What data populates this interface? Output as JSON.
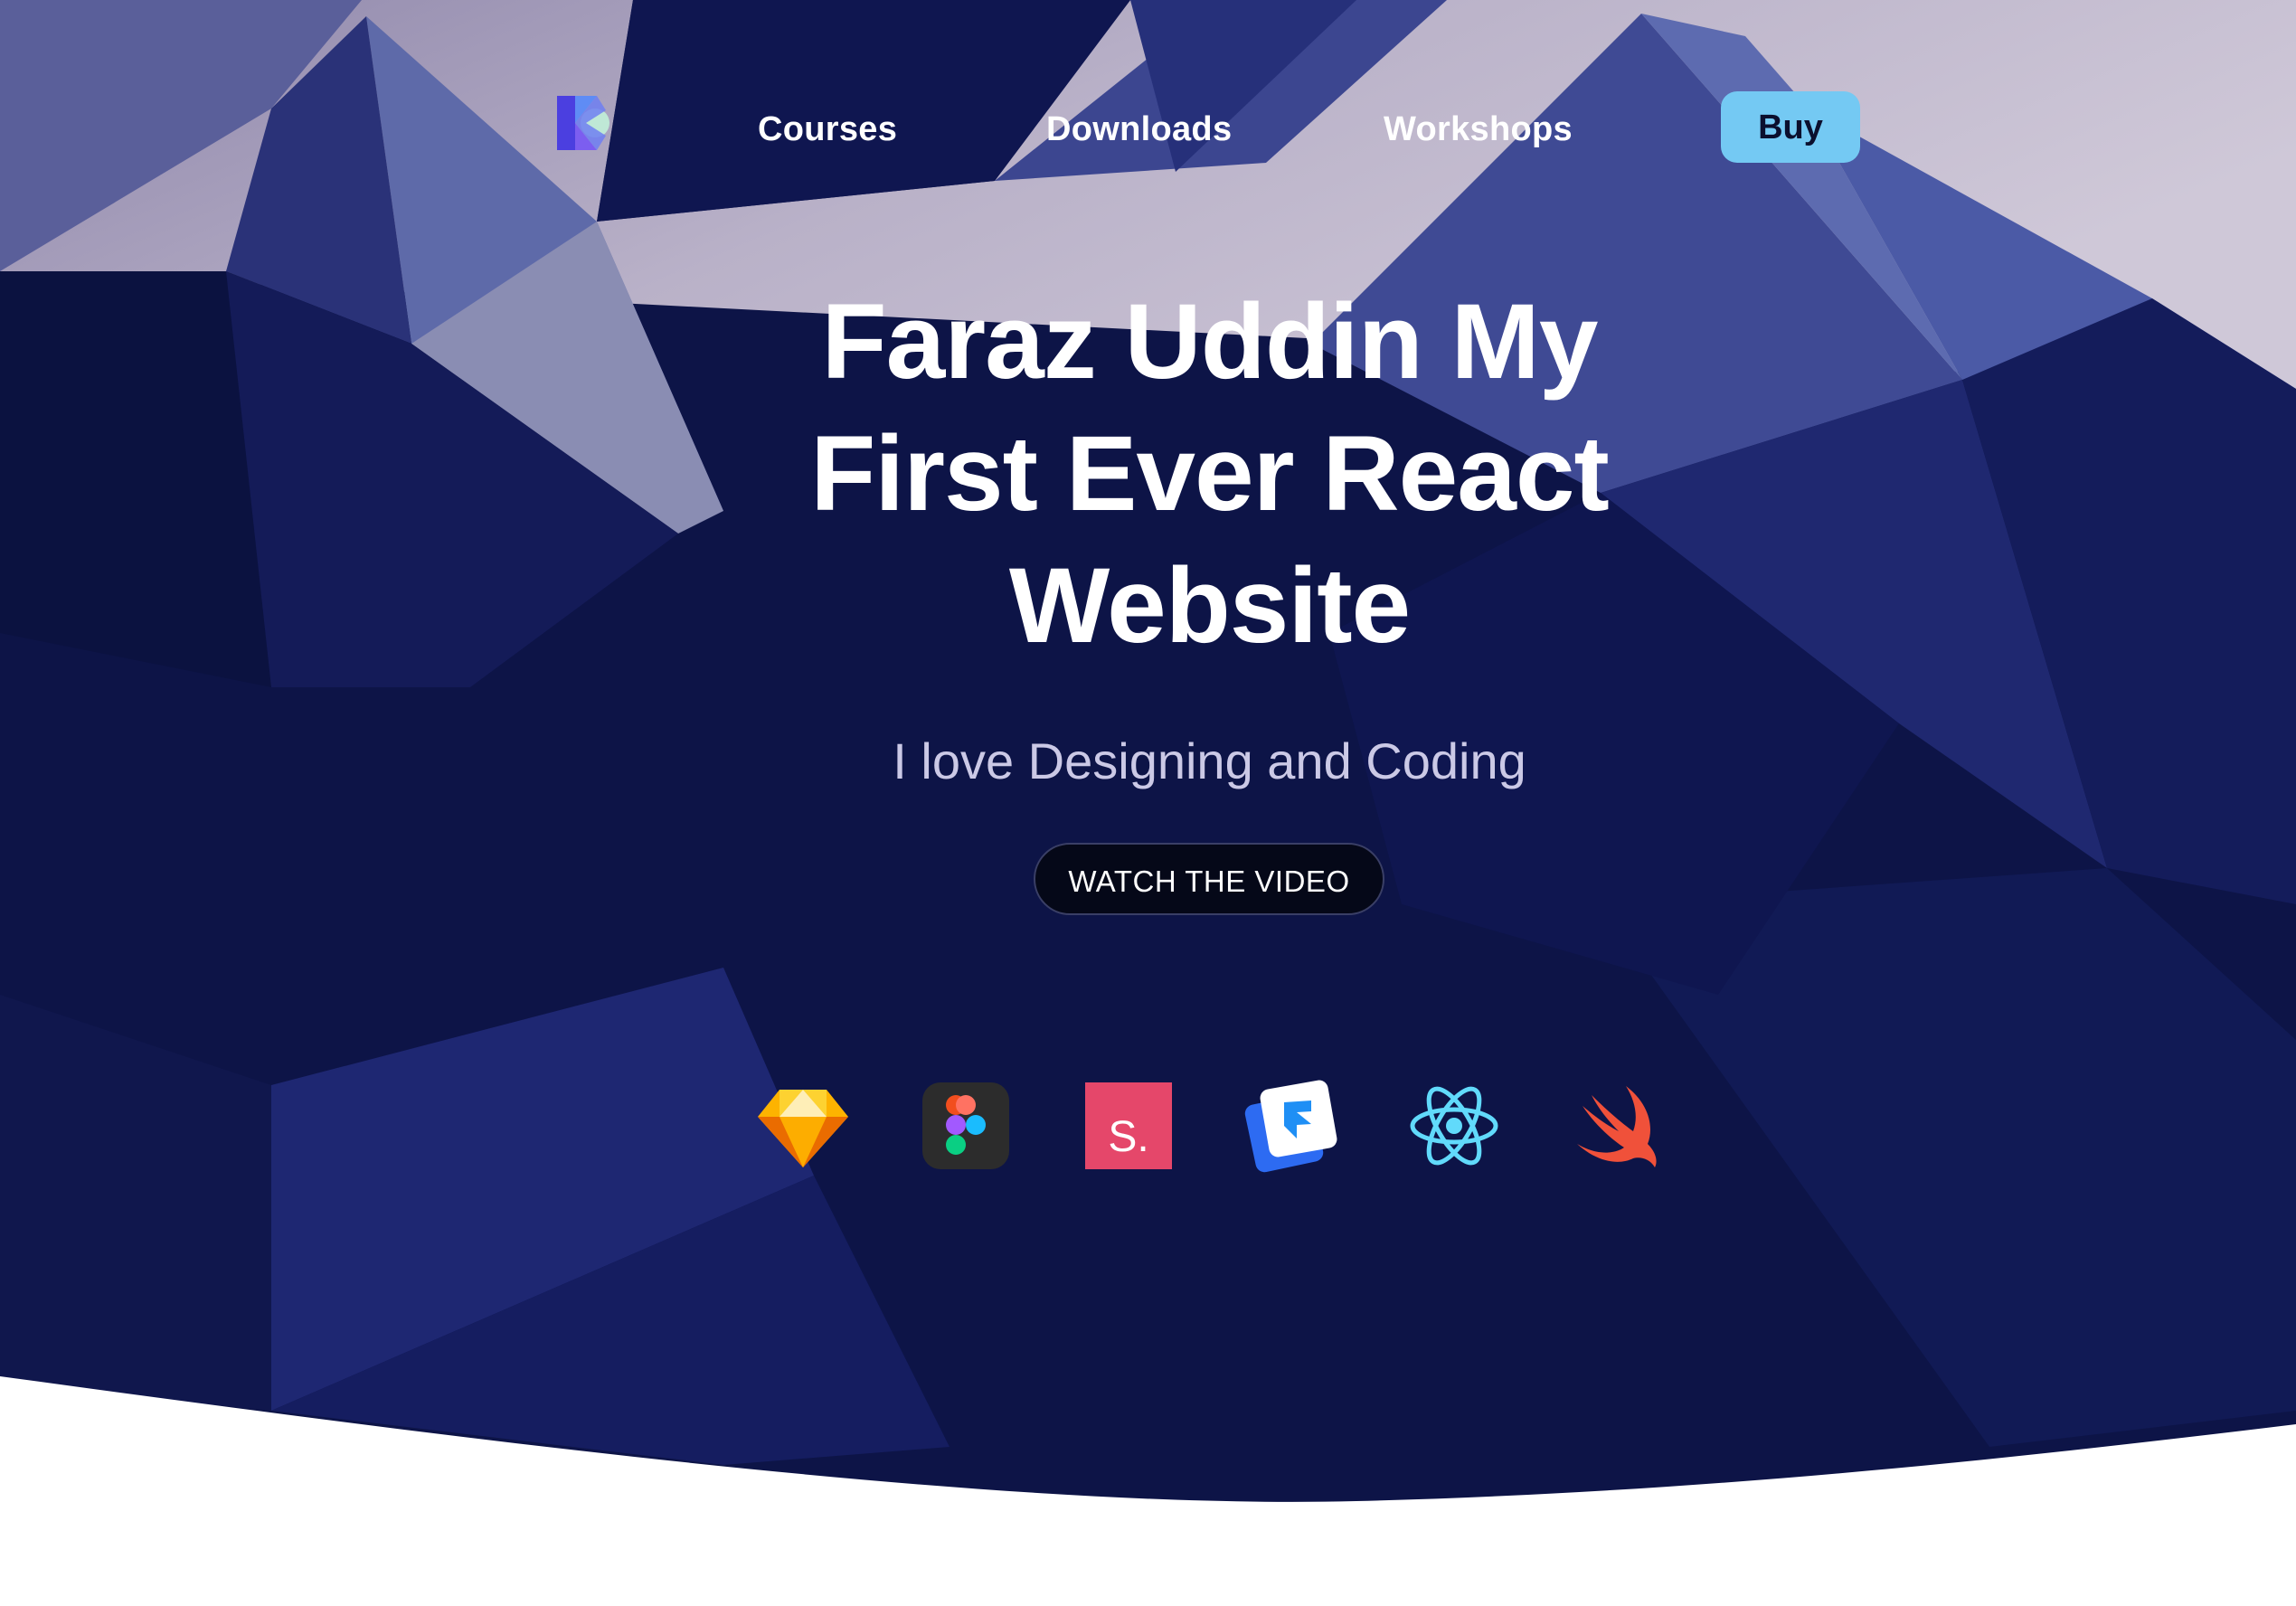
{
  "nav": {
    "logo_icon": "brand-logo-icon",
    "links": [
      "Courses",
      "Downloads",
      "Workshops"
    ],
    "buy_label": "Buy"
  },
  "hero": {
    "title": "Faraz Uddin My First Ever React Website",
    "subtitle": "I love Designing and Coding",
    "cta_label": "WATCH THE VIDEO"
  },
  "tools": [
    {
      "icon": "sketch-icon"
    },
    {
      "icon": "figma-icon"
    },
    {
      "icon": "studio-icon",
      "label": "S."
    },
    {
      "icon": "framer-icon"
    },
    {
      "icon": "react-icon"
    },
    {
      "icon": "swift-icon"
    }
  ],
  "colors": {
    "hero_background": "#0d1447",
    "buy_button": "#74c9f3",
    "cta_background": "#050818",
    "page_background": "#ffffff"
  }
}
